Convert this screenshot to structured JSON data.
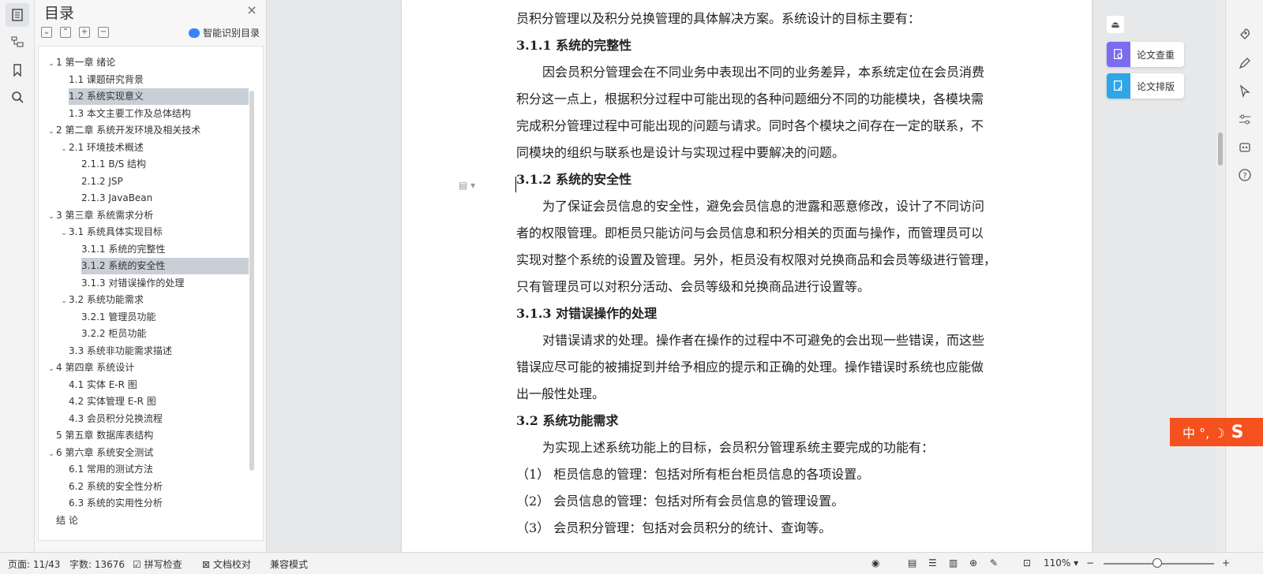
{
  "toc": {
    "title": "目录",
    "close": "×",
    "tools": [
      "⌄",
      "⌃",
      "+",
      "−"
    ],
    "ai_label": "智能识别目录",
    "items": [
      {
        "label": "1  第一章  绪论",
        "caret": "⌄"
      },
      {
        "label": "1.1  课题研究背景",
        "caret": ""
      },
      {
        "label": "1.2  系统实现意义",
        "caret": ""
      },
      {
        "label": "1.3  本文主要工作及总体结构",
        "caret": ""
      },
      {
        "label": "2  第二章  系统开发环境及相关技术",
        "caret": "⌄"
      },
      {
        "label": "2.1 环境技术概述",
        "caret": "⌄"
      },
      {
        "label": "2.1.1 B/S 结构",
        "caret": ""
      },
      {
        "label": "2.1.2 JSP",
        "caret": ""
      },
      {
        "label": "2.1.3 JavaBean",
        "caret": ""
      },
      {
        "label": "3  第三章  系统需求分析",
        "caret": "⌄"
      },
      {
        "label": "3.1  系统具体实现目标",
        "caret": "⌄"
      },
      {
        "label": "3.1.1 系统的完整性",
        "caret": ""
      },
      {
        "label": "3.1.2  系统的安全性",
        "caret": ""
      },
      {
        "label": "3.1.3  对错误操作的处理",
        "caret": ""
      },
      {
        "label": "3.2  系统功能需求",
        "caret": "⌄"
      },
      {
        "label": "3.2.1  管理员功能",
        "caret": ""
      },
      {
        "label": "3.2.2  柜员功能",
        "caret": ""
      },
      {
        "label": "3.3  系统非功能需求描述",
        "caret": ""
      },
      {
        "label": "4 第四章  系统设计",
        "caret": "⌄"
      },
      {
        "label": "4.1  实体 E-R 图",
        "caret": ""
      },
      {
        "label": "4.2  实体管理 E-R 图",
        "caret": ""
      },
      {
        "label": "4.3  会员积分兑换流程",
        "caret": ""
      },
      {
        "label": "5 第五章  数据库表结构",
        "caret": ""
      },
      {
        "label": "6 第六章  系统安全测试",
        "caret": "⌄"
      },
      {
        "label": "6.1  常用的测试方法",
        "caret": ""
      },
      {
        "label": "6.2  系统的安全性分析",
        "caret": ""
      },
      {
        "label": "6.3  系统的实用性分析",
        "caret": ""
      },
      {
        "label": "结      论",
        "caret": ""
      }
    ]
  },
  "doc": {
    "lines": [
      "员积分管理以及积分兑换管理的具体解决方案。系统设计的目标主要有：",
      "3.1.1 系统的完整性",
      "因会员积分管理会在不同业务中表现出不同的业务差异，本系统定位在会员消费",
      "积分这一点上，根据积分过程中可能出现的各种问题细分不同的功能模块，各模块需",
      "完成积分管理过程中可能出现的问题与请求。同时各个模块之间存在一定的联系，不",
      "同模块的组织与联系也是设计与实现过程中要解决的问题。",
      "3.1.2 系统的安全性",
      "为了保证会员信息的安全性，避免会员信息的泄露和恶意修改，设计了不同访问",
      "者的权限管理。即柜员只能访问与会员信息和积分相关的页面与操作，而管理员可以",
      "实现对整个系统的设置及管理。另外，柜员没有权限对兑换商品和会员等级进行管理，",
      "只有管理员可以对积分活动、会员等级和兑换商品进行设置等。",
      "3.1.3 对错误操作的处理",
      "对错误请求的处理。操作者在操作的过程中不可避免的会出现一些错误，而这些",
      "错误应尽可能的被捕捉到并给予相应的提示和正确的处理。操作错误时系统也应能做",
      "出一般性处理。",
      "3.2 系统功能需求",
      "为实现上述系统功能上的目标，会员积分管理系统主要完成的功能有：",
      "（1）  柜员信息的管理：包括对所有柜台柜员信息的各项设置。",
      "（2）  会员信息的管理：包括对所有会员信息的管理设置。",
      "（3）  会员积分管理：包括对会员积分的统计、查询等。"
    ]
  },
  "float": {
    "check_label": "论文查重",
    "format_label": "论文排版",
    "collapse": "⏏"
  },
  "ime": {
    "label": "中 °, ☽"
  },
  "status": {
    "page": "页面: 11/43",
    "words": "字数: 13676",
    "spell": "拼写检查",
    "proof": "文档校对",
    "compat": "兼容模式",
    "zoom": "110%",
    "zoom_out": "−",
    "zoom_in": "+"
  },
  "colors": {
    "accent": "#4a7dd8",
    "ime": "#f4511e",
    "selected_row": "#c9cfd6"
  }
}
